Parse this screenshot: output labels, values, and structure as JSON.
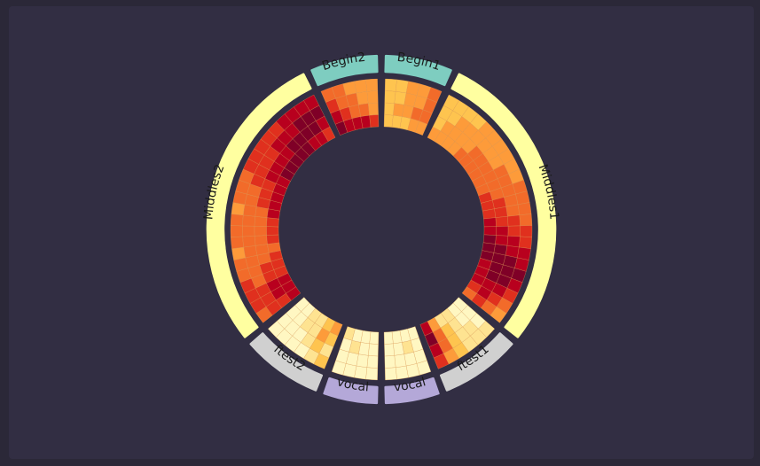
{
  "colors": {
    "page_background": "#2b2838",
    "panel_background": "#322e43",
    "cell_stroke": "#e8a35a"
  },
  "chart_data": {
    "type": "circular heatmap",
    "color_scale": [
      "#fff7c2",
      "#fee391",
      "#fec44f",
      "#fd9b3a",
      "#f26b2a",
      "#e0301e",
      "#b8001e",
      "#7f0027"
    ],
    "value_range": [
      0,
      7
    ],
    "sectors": [
      {
        "label": "Begin1",
        "label_color": "#7ecdc0",
        "values": [
          [
            2,
            2,
            3,
            3,
            4
          ],
          [
            2,
            2,
            3,
            3,
            4
          ],
          [
            2,
            3,
            3,
            4,
            4
          ],
          [
            2,
            2,
            2,
            3,
            3
          ]
        ]
      },
      {
        "label": "Middles1",
        "label_color": "#ffffa0",
        "values": [
          [
            2,
            2,
            2,
            2,
            3,
            3,
            3,
            3,
            3,
            3,
            4,
            4,
            4,
            4,
            5,
            5,
            6,
            6,
            7,
            6,
            5,
            4,
            3
          ],
          [
            2,
            2,
            3,
            3,
            3,
            3,
            3,
            3,
            4,
            4,
            4,
            4,
            4,
            5,
            5,
            6,
            6,
            7,
            7,
            7,
            6,
            5,
            4
          ],
          [
            2,
            3,
            3,
            3,
            3,
            4,
            4,
            4,
            4,
            4,
            4,
            5,
            5,
            5,
            6,
            6,
            7,
            7,
            7,
            7,
            6,
            6,
            5
          ],
          [
            3,
            3,
            3,
            3,
            4,
            4,
            4,
            4,
            4,
            4,
            5,
            5,
            5,
            6,
            6,
            7,
            7,
            7,
            6,
            6,
            6,
            5,
            4
          ]
        ]
      },
      {
        "label": "ftest1",
        "label_color": "#d0d0d0",
        "values": [
          [
            1,
            1,
            1,
            2,
            3,
            5
          ],
          [
            0,
            1,
            1,
            2,
            4,
            6
          ],
          [
            0,
            0,
            1,
            2,
            4,
            7
          ],
          [
            0,
            0,
            1,
            1,
            3,
            6
          ]
        ]
      },
      {
        "label": "vocal",
        "label_color": "#b4a8d8",
        "values": [
          [
            0,
            0,
            0,
            0
          ],
          [
            0,
            0,
            0,
            0
          ],
          [
            0,
            1,
            0,
            0
          ],
          [
            0,
            0,
            0,
            0
          ]
        ]
      },
      {
        "label": "vocal",
        "label_color": "#b4a8d8",
        "values": [
          [
            0,
            0,
            0,
            0
          ],
          [
            0,
            0,
            0,
            0
          ],
          [
            0,
            0,
            1,
            0
          ],
          [
            0,
            0,
            0,
            1
          ]
        ]
      },
      {
        "label": "ftest2",
        "label_color": "#d0d0d0",
        "values": [
          [
            2,
            1,
            0,
            0,
            0,
            0
          ],
          [
            1,
            2,
            1,
            0,
            0,
            0
          ],
          [
            2,
            3,
            1,
            1,
            0,
            0
          ],
          [
            3,
            2,
            1,
            1,
            0,
            0
          ]
        ]
      },
      {
        "label": "Middles2",
        "label_color": "#ffffa0",
        "values": [
          [
            4,
            5,
            5,
            5,
            4,
            4,
            3,
            4,
            4,
            4,
            3,
            4,
            4,
            4,
            5,
            5,
            5,
            5,
            5,
            6,
            6,
            6,
            6
          ],
          [
            5,
            5,
            5,
            4,
            4,
            4,
            4,
            4,
            4,
            4,
            4,
            4,
            4,
            5,
            5,
            5,
            5,
            6,
            6,
            6,
            7,
            7,
            7
          ],
          [
            5,
            6,
            6,
            5,
            5,
            4,
            4,
            4,
            4,
            4,
            4,
            5,
            5,
            5,
            6,
            6,
            6,
            6,
            7,
            7,
            7,
            7,
            6
          ],
          [
            6,
            6,
            6,
            5,
            5,
            5,
            4,
            5,
            5,
            5,
            6,
            6,
            6,
            6,
            6,
            7,
            7,
            7,
            7,
            7,
            6,
            6,
            5
          ]
        ]
      },
      {
        "label": "Begin2",
        "label_color": "#7ecdc0",
        "values": [
          [
            4,
            4,
            3,
            3,
            3
          ],
          [
            5,
            4,
            4,
            3,
            3
          ],
          [
            6,
            5,
            4,
            4,
            3
          ],
          [
            7,
            6,
            6,
            6,
            5
          ]
        ]
      }
    ]
  }
}
